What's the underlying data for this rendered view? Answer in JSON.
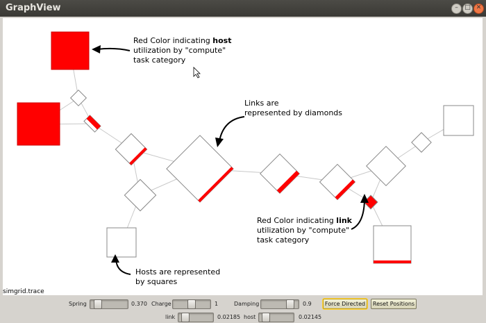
{
  "window": {
    "title": "GraphView",
    "close_glyph": "✕",
    "minimize_glyph": "–",
    "maximize_glyph": "□"
  },
  "canvas": {
    "trace_label": "simgrid.trace",
    "accent_color": "#ff0000",
    "node_stroke": "#888888"
  },
  "annotations": {
    "host_util": {
      "prefix": "Red Color indicating ",
      "bold": "host",
      "line2": "utilization by \"compute\"",
      "line3": "task category"
    },
    "links": {
      "line1": "Links are",
      "line2": "represented by diamonds"
    },
    "link_util": {
      "prefix": "Red Color indicating ",
      "bold": "link",
      "line2": "utilization by \"compute\"",
      "line3": "task category"
    },
    "hosts": {
      "line1": "Hosts are represented",
      "line2": "by squares"
    }
  },
  "controls": {
    "spring": {
      "label": "Spring",
      "value": "0.370",
      "fraction": 0.12
    },
    "charge": {
      "label": "Charge",
      "value": "1",
      "fraction": 0.5
    },
    "damping": {
      "label": "Damping",
      "value": "0.9",
      "fraction": 0.85
    },
    "force_directed": "Force Directed",
    "reset_positions": "Reset Positions",
    "link": {
      "label": "link",
      "value": "0.02185",
      "fraction": 0.1
    },
    "host": {
      "label": "host",
      "value": "0.02145",
      "fraction": 0.1
    }
  }
}
